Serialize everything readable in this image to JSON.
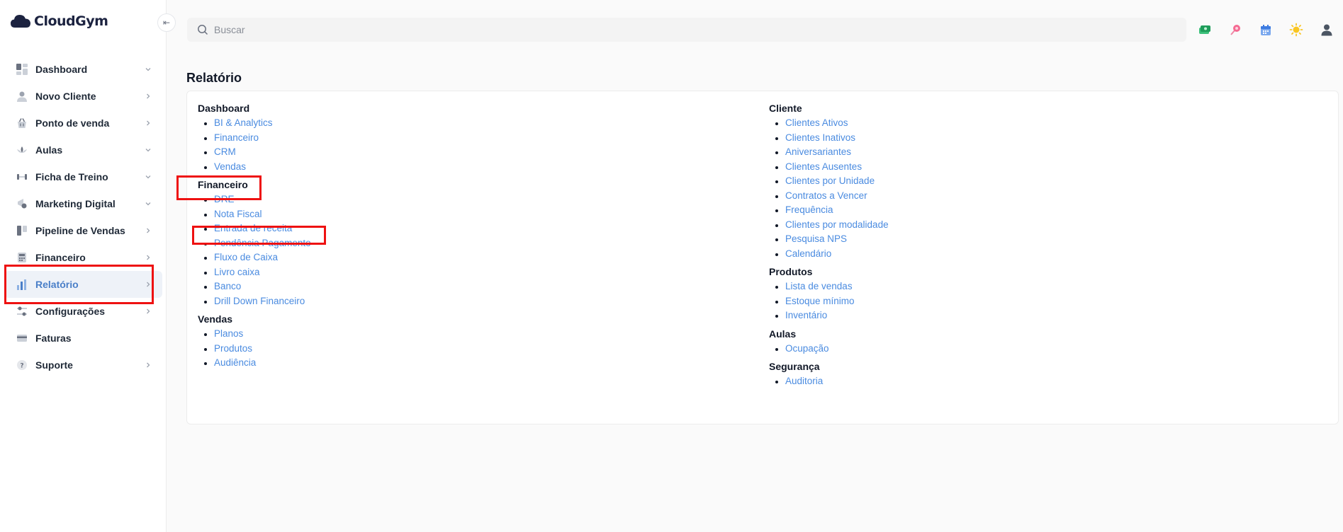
{
  "app": {
    "name": "CloudGym"
  },
  "sidebar": {
    "collapse_icon": "collapse-left-icon",
    "items": [
      {
        "label": "Dashboard",
        "icon": "dashboard-icon",
        "chevron": "down"
      },
      {
        "label": "Novo Cliente",
        "icon": "user-icon",
        "chevron": "right"
      },
      {
        "label": "Ponto de venda",
        "icon": "basket-icon",
        "chevron": "right"
      },
      {
        "label": "Aulas",
        "icon": "lotus-icon",
        "chevron": "down"
      },
      {
        "label": "Ficha de Treino",
        "icon": "dumbbell-icon",
        "chevron": "down"
      },
      {
        "label": "Marketing Digital",
        "icon": "megaphone-icon",
        "chevron": "down"
      },
      {
        "label": "Pipeline de Vendas",
        "icon": "pipeline-icon",
        "chevron": "right"
      },
      {
        "label": "Financeiro",
        "icon": "calculator-icon",
        "chevron": "right"
      },
      {
        "label": "Relatório",
        "icon": "bar-chart-icon",
        "chevron": "right",
        "active": true
      },
      {
        "label": "Configurações",
        "icon": "sliders-icon",
        "chevron": "right"
      },
      {
        "label": "Faturas",
        "icon": "credit-card-icon",
        "chevron": ""
      },
      {
        "label": "Suporte",
        "icon": "help-icon",
        "chevron": "right"
      }
    ]
  },
  "header": {
    "search_placeholder": "Buscar",
    "icons": [
      "money-icon",
      "pin-icon",
      "calendar-icon",
      "sun-icon",
      "account-icon"
    ]
  },
  "page": {
    "title": "Relatório"
  },
  "report": {
    "left": [
      {
        "title": "Dashboard",
        "items": [
          "BI & Analytics",
          "Financeiro",
          "CRM",
          "Vendas"
        ]
      },
      {
        "title": "Financeiro",
        "items": [
          "DRE",
          "Nota Fiscal",
          "Entrada de receita",
          "Pendência Pagamento",
          "Fluxo de Caixa",
          "Livro caixa",
          "Banco",
          "Drill Down Financeiro"
        ]
      },
      {
        "title": "Vendas",
        "items": [
          "Planos",
          "Produtos",
          "Audiência"
        ]
      }
    ],
    "right": [
      {
        "title": "Cliente",
        "items": [
          "Clientes Ativos",
          "Clientes Inativos",
          "Aniversariantes",
          "Clientes Ausentes",
          "Clientes por Unidade",
          "Contratos a Vencer",
          "Frequência",
          "Clientes por modalidade",
          "Pesquisa NPS",
          "Calendário"
        ]
      },
      {
        "title": "Produtos",
        "items": [
          "Lista de vendas",
          "Estoque mínimo",
          "Inventário"
        ]
      },
      {
        "title": "Aulas",
        "items": [
          "Ocupação"
        ]
      },
      {
        "title": "Segurança",
        "items": [
          "Auditoria"
        ]
      }
    ]
  },
  "colors": {
    "accent": "#4a7fc8",
    "link": "#4a8be0",
    "highlight": "#ee1111",
    "logo": "#1c2340"
  }
}
